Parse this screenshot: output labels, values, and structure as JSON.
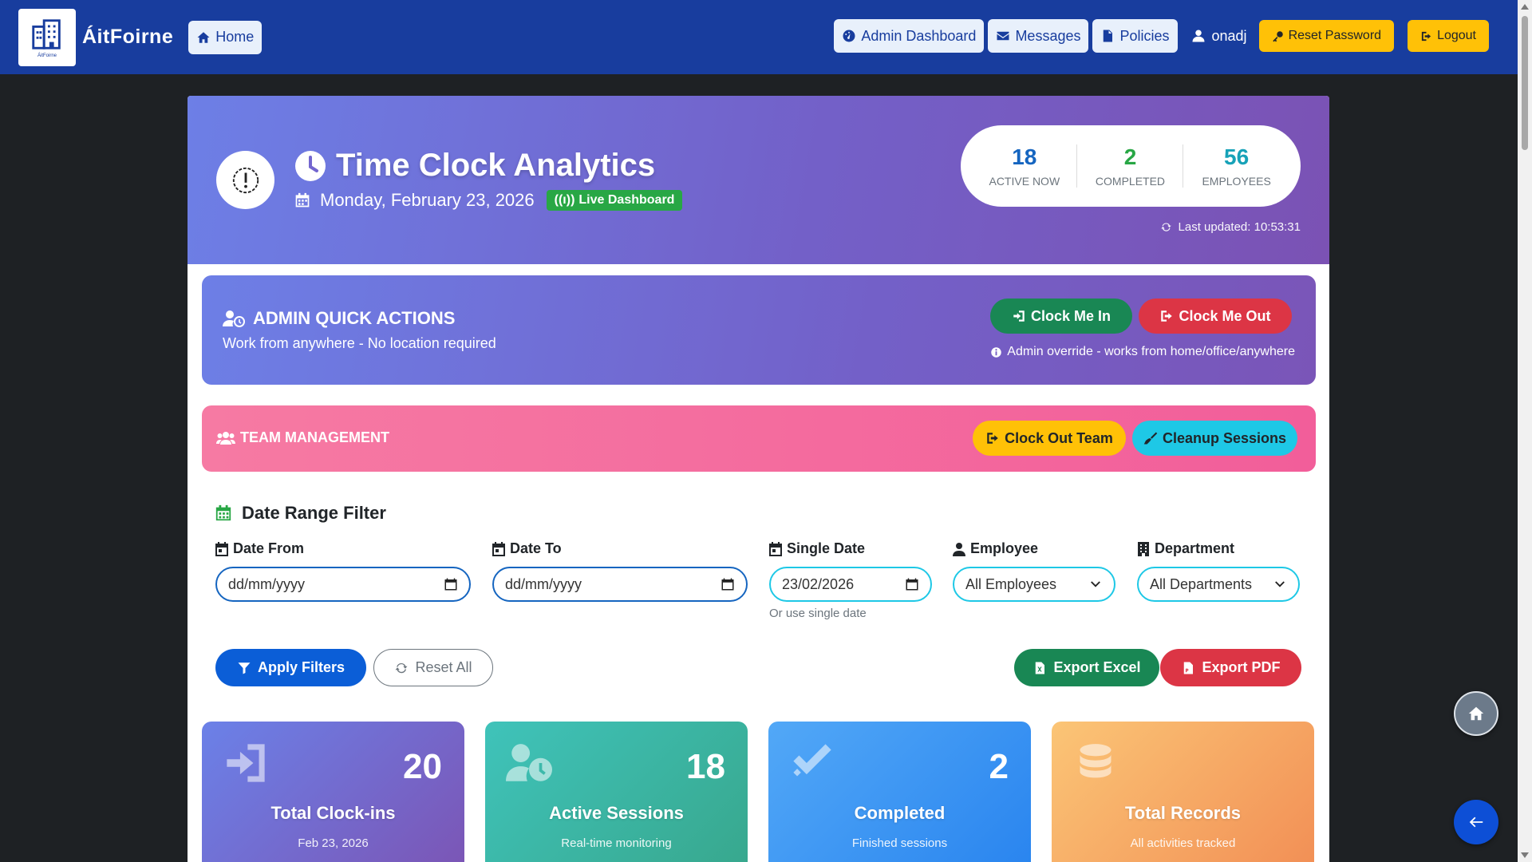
{
  "nav": {
    "brand": "ÁitFoirne",
    "logo_small": "ÁitFoirne",
    "home": "Home",
    "admin_dashboard": "Admin Dashboard",
    "messages": "Messages",
    "policies": "Policies",
    "username": "onadj",
    "reset_password": "Reset Password",
    "logout": "Logout"
  },
  "hero": {
    "title": "Time Clock Analytics",
    "date": "Monday, February 23, 2026",
    "live_badge": "Live Dashboard",
    "stats": [
      {
        "value": "18",
        "label": "ACTIVE NOW",
        "color": "#1565c0"
      },
      {
        "value": "2",
        "label": "COMPLETED",
        "color": "#28a745"
      },
      {
        "value": "56",
        "label": "EMPLOYEES",
        "color": "#17a2b8"
      }
    ],
    "last_updated": "Last updated: 10:53:31"
  },
  "quick_actions": {
    "title": "ADMIN QUICK ACTIONS",
    "subtitle": "Work from anywhere - No location required",
    "clock_in": "Clock Me In",
    "clock_out": "Clock Me Out",
    "note": "Admin override - works from home/office/anywhere"
  },
  "team": {
    "title": "TEAM MANAGEMENT",
    "clock_out_team": "Clock Out Team",
    "cleanup": "Cleanup Sessions"
  },
  "filter": {
    "title": "Date Range Filter",
    "date_from_label": "Date From",
    "date_from_value": "dd/mm/yyyy",
    "date_to_label": "Date To",
    "date_to_value": "dd/mm/yyyy",
    "single_date_label": "Single Date",
    "single_date_value": "23/02/2026",
    "single_date_hint": "Or use single date",
    "employee_label": "Employee",
    "employee_value": "All Employees",
    "department_label": "Department",
    "department_value": "All Departments",
    "apply": "Apply Filters",
    "reset": "Reset All",
    "export_excel": "Export Excel",
    "export_pdf": "Export PDF"
  },
  "cards": [
    {
      "value": "20",
      "title": "Total Clock-ins",
      "sub": "Feb 23, 2026"
    },
    {
      "value": "18",
      "title": "Active Sessions",
      "sub": "Real-time monitoring"
    },
    {
      "value": "2",
      "title": "Completed",
      "sub": "Finished sessions"
    },
    {
      "value": "",
      "title": "Total Records",
      "sub": "All activities tracked"
    }
  ],
  "colors": {
    "navbar": "#183d9e",
    "accent_green": "#198754",
    "accent_red": "#dc3545",
    "accent_yellow": "#ffc107",
    "accent_cyan": "#1ec8e6"
  }
}
